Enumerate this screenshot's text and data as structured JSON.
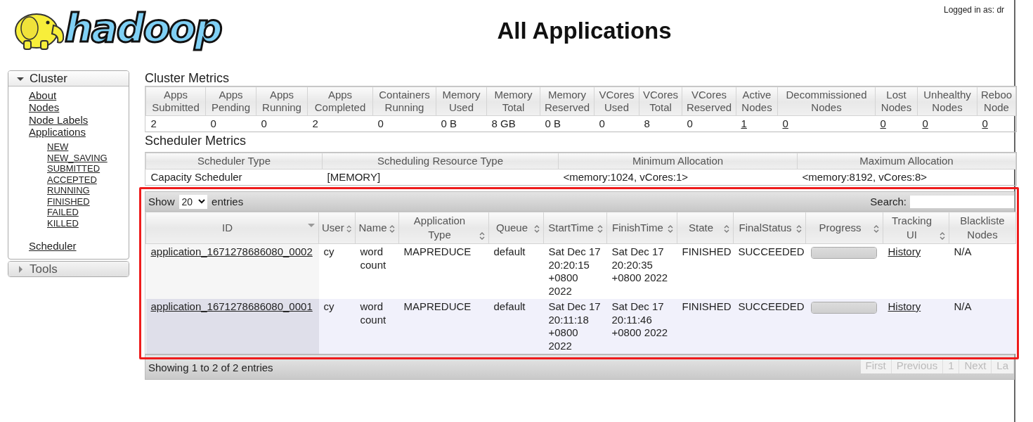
{
  "header": {
    "logo_text": "hadoop",
    "title": "All Applications",
    "user_label": "Logged in as: dr"
  },
  "sidebar": {
    "sections": [
      {
        "label": "Cluster",
        "expanded": true,
        "items": [
          {
            "label": "About"
          },
          {
            "label": "Nodes"
          },
          {
            "label": "Node Labels"
          },
          {
            "label": "Applications",
            "children": [
              {
                "label": "NEW"
              },
              {
                "label": "NEW_SAVING"
              },
              {
                "label": "SUBMITTED"
              },
              {
                "label": "ACCEPTED"
              },
              {
                "label": "RUNNING"
              },
              {
                "label": "FINISHED"
              },
              {
                "label": "FAILED"
              },
              {
                "label": "KILLED"
              }
            ]
          },
          {
            "label": "Scheduler"
          }
        ]
      },
      {
        "label": "Tools",
        "expanded": false
      }
    ]
  },
  "cluster_metrics": {
    "title": "Cluster Metrics",
    "columns": [
      {
        "label": "Apps Submitted",
        "value": "2",
        "link": false
      },
      {
        "label": "Apps Pending",
        "value": "0",
        "link": false
      },
      {
        "label": "Apps Running",
        "value": "0",
        "link": false
      },
      {
        "label": "Apps Completed",
        "value": "2",
        "link": false
      },
      {
        "label": "Containers Running",
        "value": "0",
        "link": false
      },
      {
        "label": "Memory Used",
        "value": "0 B",
        "link": false
      },
      {
        "label": "Memory Total",
        "value": "8 GB",
        "link": false
      },
      {
        "label": "Memory Reserved",
        "value": "0 B",
        "link": false
      },
      {
        "label": "VCores Used",
        "value": "0",
        "link": false
      },
      {
        "label": "VCores Total",
        "value": "8",
        "link": false
      },
      {
        "label": "VCores Reserved",
        "value": "0",
        "link": false
      },
      {
        "label": "Active Nodes",
        "value": "1",
        "link": true
      },
      {
        "label": "Decommissioned Nodes",
        "value": "0",
        "link": true
      },
      {
        "label": "Lost Nodes",
        "value": "0",
        "link": true
      },
      {
        "label": "Unhealthy Nodes",
        "value": "0",
        "link": true
      },
      {
        "label": "Reboo Node",
        "value": "0",
        "link": true
      }
    ]
  },
  "scheduler_metrics": {
    "title": "Scheduler Metrics",
    "columns": [
      "Scheduler Type",
      "Scheduling Resource Type",
      "Minimum Allocation",
      "Maximum Allocation"
    ],
    "rows": [
      [
        "Capacity Scheduler",
        "[MEMORY]",
        "<memory:1024, vCores:1>",
        "<memory:8192, vCores:8>"
      ]
    ]
  },
  "applications": {
    "show_label": "Show",
    "page_size": "20",
    "entries_label": "entries",
    "search_label": "Search:",
    "columns": [
      {
        "label": "ID",
        "sortable": true,
        "sorted": true
      },
      {
        "label": "User",
        "sortable": true,
        "sorted": false
      },
      {
        "label": "Name",
        "sortable": true,
        "sorted": false
      },
      {
        "label": "Application Type",
        "sortable": true,
        "sorted": false
      },
      {
        "label": "Queue",
        "sortable": true,
        "sorted": false
      },
      {
        "label": "StartTime",
        "sortable": true,
        "sorted": false
      },
      {
        "label": "FinishTime",
        "sortable": true,
        "sorted": false
      },
      {
        "label": "State",
        "sortable": true,
        "sorted": false
      },
      {
        "label": "FinalStatus",
        "sortable": true,
        "sorted": false
      },
      {
        "label": "Progress",
        "sortable": true,
        "sorted": false
      },
      {
        "label": "Tracking UI",
        "sortable": true,
        "sorted": false
      },
      {
        "label": "Blackliste Nodes",
        "sortable": false
      }
    ],
    "rows": [
      {
        "id": "application_1671278686080_0002",
        "user": "cy",
        "name": "word count",
        "type": "MAPREDUCE",
        "queue": "default",
        "start_time": "Sat Dec 17 20:20:15 +0800 2022",
        "finish_time": "Sat Dec 17 20:20:35 +0800 2022",
        "state": "FINISHED",
        "final_status": "SUCCEEDED",
        "progress": {
          "level": 1
        },
        "tracking_ui": "History",
        "blacklisted_nodes": "N/A"
      },
      {
        "id": "application_1671278686080_0001",
        "user": "cy",
        "name": "word count",
        "type": "MAPREDUCE",
        "queue": "default",
        "start_time": "Sat Dec 17 20:11:18 +0800 2022",
        "finish_time": "Sat Dec 17 20:11:46 +0800 2022",
        "state": "FINISHED",
        "final_status": "SUCCEEDED",
        "progress": {
          "level": 1
        },
        "tracking_ui": "History",
        "blacklisted_nodes": "N/A"
      }
    ],
    "info": "Showing 1 to 2 of 2 entries",
    "pager": [
      {
        "label": "First",
        "disabled": true
      },
      {
        "label": "Previous",
        "disabled": true
      },
      {
        "label": "1",
        "disabled": true
      },
      {
        "label": "Next",
        "disabled": true
      },
      {
        "label": "La",
        "disabled": true
      }
    ]
  }
}
